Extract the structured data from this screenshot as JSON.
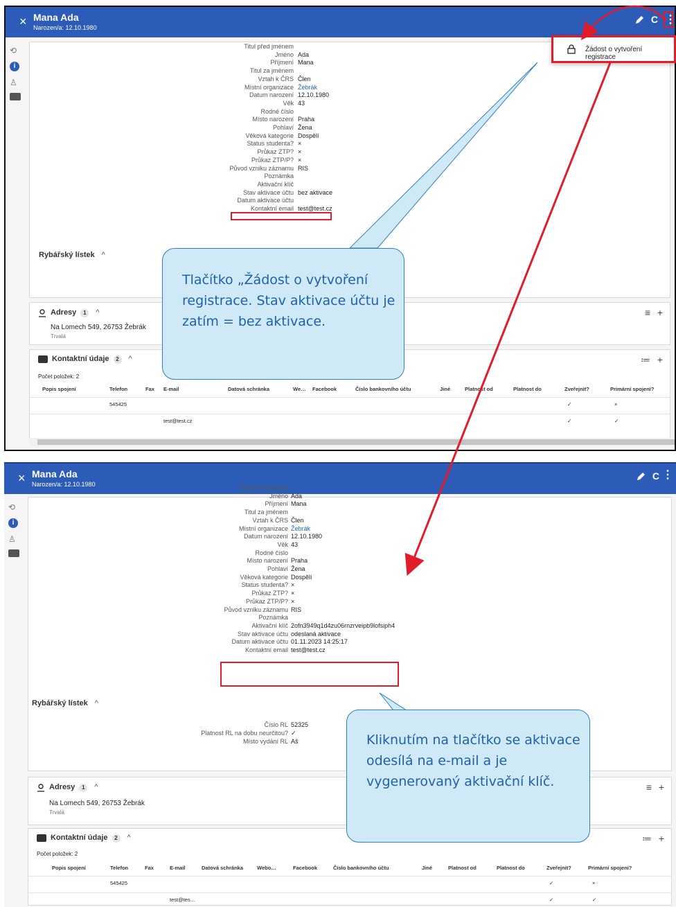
{
  "header": {
    "close_glyph": "×",
    "name": "Mana Ada",
    "dob": "Narozen/a: 12.10.1980",
    "refresh_glyph": "C",
    "more_glyph": "⋮"
  },
  "context_menu": {
    "item": "Žádost o vytvoření registrace"
  },
  "sidebar_icons": [
    "history-icon",
    "info-icon",
    "user-icon",
    "contact-card-icon"
  ],
  "fields": [
    {
      "label": "Titul před jménem",
      "value": ""
    },
    {
      "label": "Jméno",
      "value": "Ada"
    },
    {
      "label": "Příjmení",
      "value": "Mana"
    },
    {
      "label": "Titul za jménem",
      "value": ""
    },
    {
      "label": "Vztah k ČRS",
      "value": "Člen"
    },
    {
      "label": "Místní organizace",
      "value": "Žebrák"
    },
    {
      "label": "Datum narození",
      "value": "12.10.1980"
    },
    {
      "label": "Věk",
      "value": "43"
    },
    {
      "label": "Rodné číslo",
      "value": ""
    },
    {
      "label": "Místo narození",
      "value": "Praha"
    },
    {
      "label": "Pohlaví",
      "value": "Žena"
    },
    {
      "label": "Věková kategorie",
      "value": "Dospělí"
    },
    {
      "label": "Status studenta?",
      "value": "×"
    },
    {
      "label": "Průkaz ZTP?",
      "value": "×"
    },
    {
      "label": "Průkaz ZTP/P?",
      "value": "×"
    },
    {
      "label": "Původ vzniku záznamu",
      "value": "RIS"
    },
    {
      "label": "Poznámka",
      "value": ""
    },
    {
      "label": "Aktivační klíč",
      "value": ""
    },
    {
      "label": "Stav aktivace účtu",
      "value": "bez aktivace"
    },
    {
      "label": "Datum aktivace účtu",
      "value": ""
    },
    {
      "label": "Kontaktní email",
      "value": "test@test.cz"
    }
  ],
  "fields2_overrides": {
    "activation_key": "2ofn3949q1d4zu06rnzrveipb9lofsiph4",
    "activation_state": "odeslaná aktivace",
    "activation_date": "01.11.2023 14:25:17"
  },
  "fishing_license": {
    "title": "Rybářský lístek",
    "chevron": "^",
    "rows": [
      {
        "label": "Číslo RL",
        "value": "52325"
      },
      {
        "label": "Platnost RL na dobu neurčitou?",
        "value": "✓"
      },
      {
        "label": "Místo vydání RL",
        "value": "Aš"
      }
    ]
  },
  "addresses": {
    "title": "Adresy",
    "count": "1",
    "chevron": "^",
    "address": "Na Lomech 549, 26753 Žebrák",
    "type": "Trvalá",
    "actions": [
      "≡",
      "+"
    ]
  },
  "contacts": {
    "title": "Kontaktní údaje",
    "count": "2",
    "chevron": "^",
    "count_label": "Počet položek: 2",
    "actions": [
      "≔",
      "+"
    ],
    "columns": [
      "Popis spojení",
      "Telefon",
      "Fax",
      "E-mail",
      "Datová schránka",
      "We…",
      "Facebook",
      "Číslo bankovního účtu",
      "Jiné",
      "Platnost od",
      "Platnost do",
      "Zveřejnit?",
      "Primární spojení?"
    ],
    "columns2": [
      "Popis spojení",
      "Telefon",
      "Fax",
      "E-mail",
      "Datová schránka",
      "Webo…",
      "Facebook",
      "Číslo bankovního účtu",
      "Jiné",
      "Platnost od",
      "Platnost do",
      "Zveřejnit?",
      "Primární spojení?"
    ],
    "rows": [
      {
        "phone": "545425",
        "email": "",
        "publish": "✓",
        "primary": "×"
      },
      {
        "phone": "",
        "email": "test@test.cz",
        "publish": "✓",
        "primary": "✓"
      }
    ],
    "row2_email_truncated": "test@tes…"
  },
  "callouts": [
    "Tlačítko „Žádost o vytvoření registrace. Stav aktivace účtu je zatím = bez aktivace.",
    "Kliknutím na tlačítko se aktivace odesílá na e-mail a je vygenerovaný aktivační klíč."
  ],
  "colors": {
    "header": "#2c5cb8",
    "highlight": "#e21d2a",
    "callout_fill": "#cfe9f7",
    "callout_text": "#1e62a8",
    "link": "#1e66c8"
  }
}
